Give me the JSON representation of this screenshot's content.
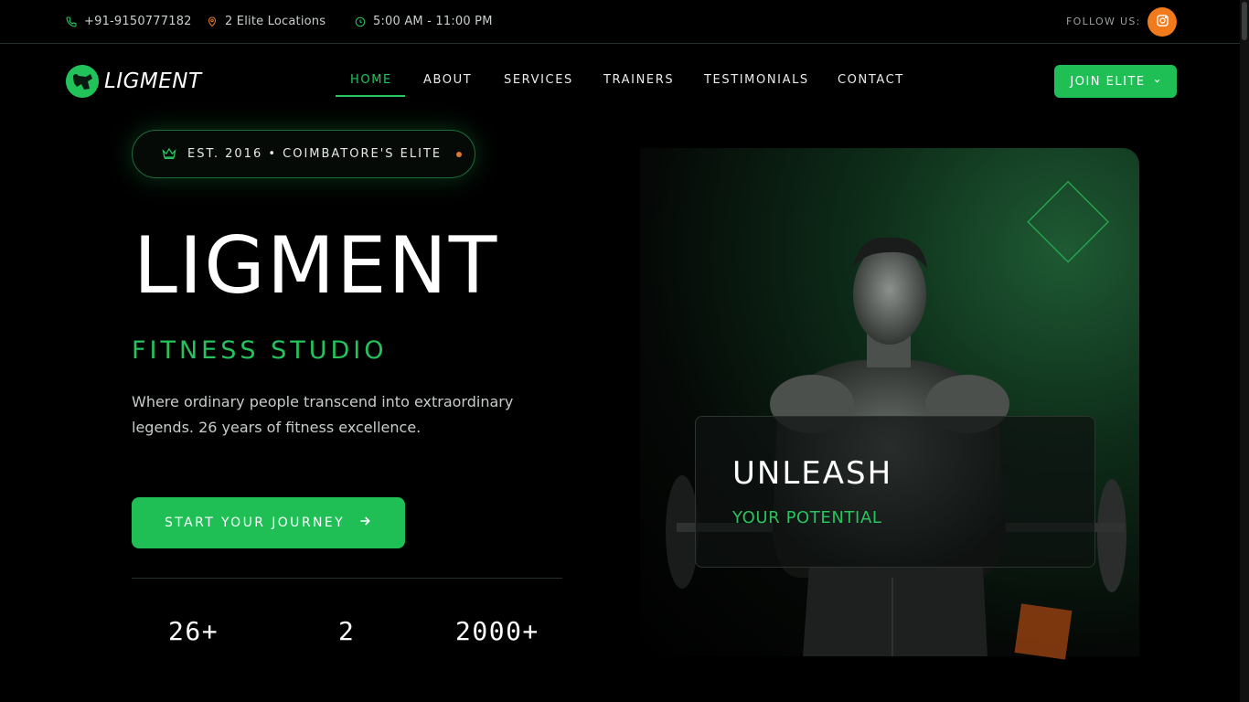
{
  "topbar": {
    "phone": "+91-9150777182",
    "locations": "2 Elite Locations",
    "hours": "5:00 AM - 11:00 PM",
    "follow_label": "FOLLOW US:"
  },
  "brand": {
    "name": "LIGMENT"
  },
  "nav": {
    "items": [
      {
        "label": "HOME",
        "active": true
      },
      {
        "label": "ABOUT"
      },
      {
        "label": "SERVICES"
      },
      {
        "label": "TRAINERS"
      },
      {
        "label": "TESTIMONIALS"
      },
      {
        "label": "CONTACT"
      }
    ],
    "join_label": "JOIN ELITE"
  },
  "hero": {
    "badge": "EST. 2016 • COIMBATORE'S ELITE",
    "title": "LIGMENT",
    "subtitle": "FITNESS STUDIO",
    "description": "Where ordinary people transcend into extraordinary legends. 26 years of fitness excellence.",
    "cta_label": "START YOUR JOURNEY",
    "stats": [
      "26+",
      "2",
      "2000+"
    ]
  },
  "card": {
    "title": "UNLEASH",
    "subtitle": "YOUR POTENTIAL"
  },
  "colors": {
    "accent": "#1fbf56",
    "orange": "#f07a1c",
    "background": "#000000"
  }
}
